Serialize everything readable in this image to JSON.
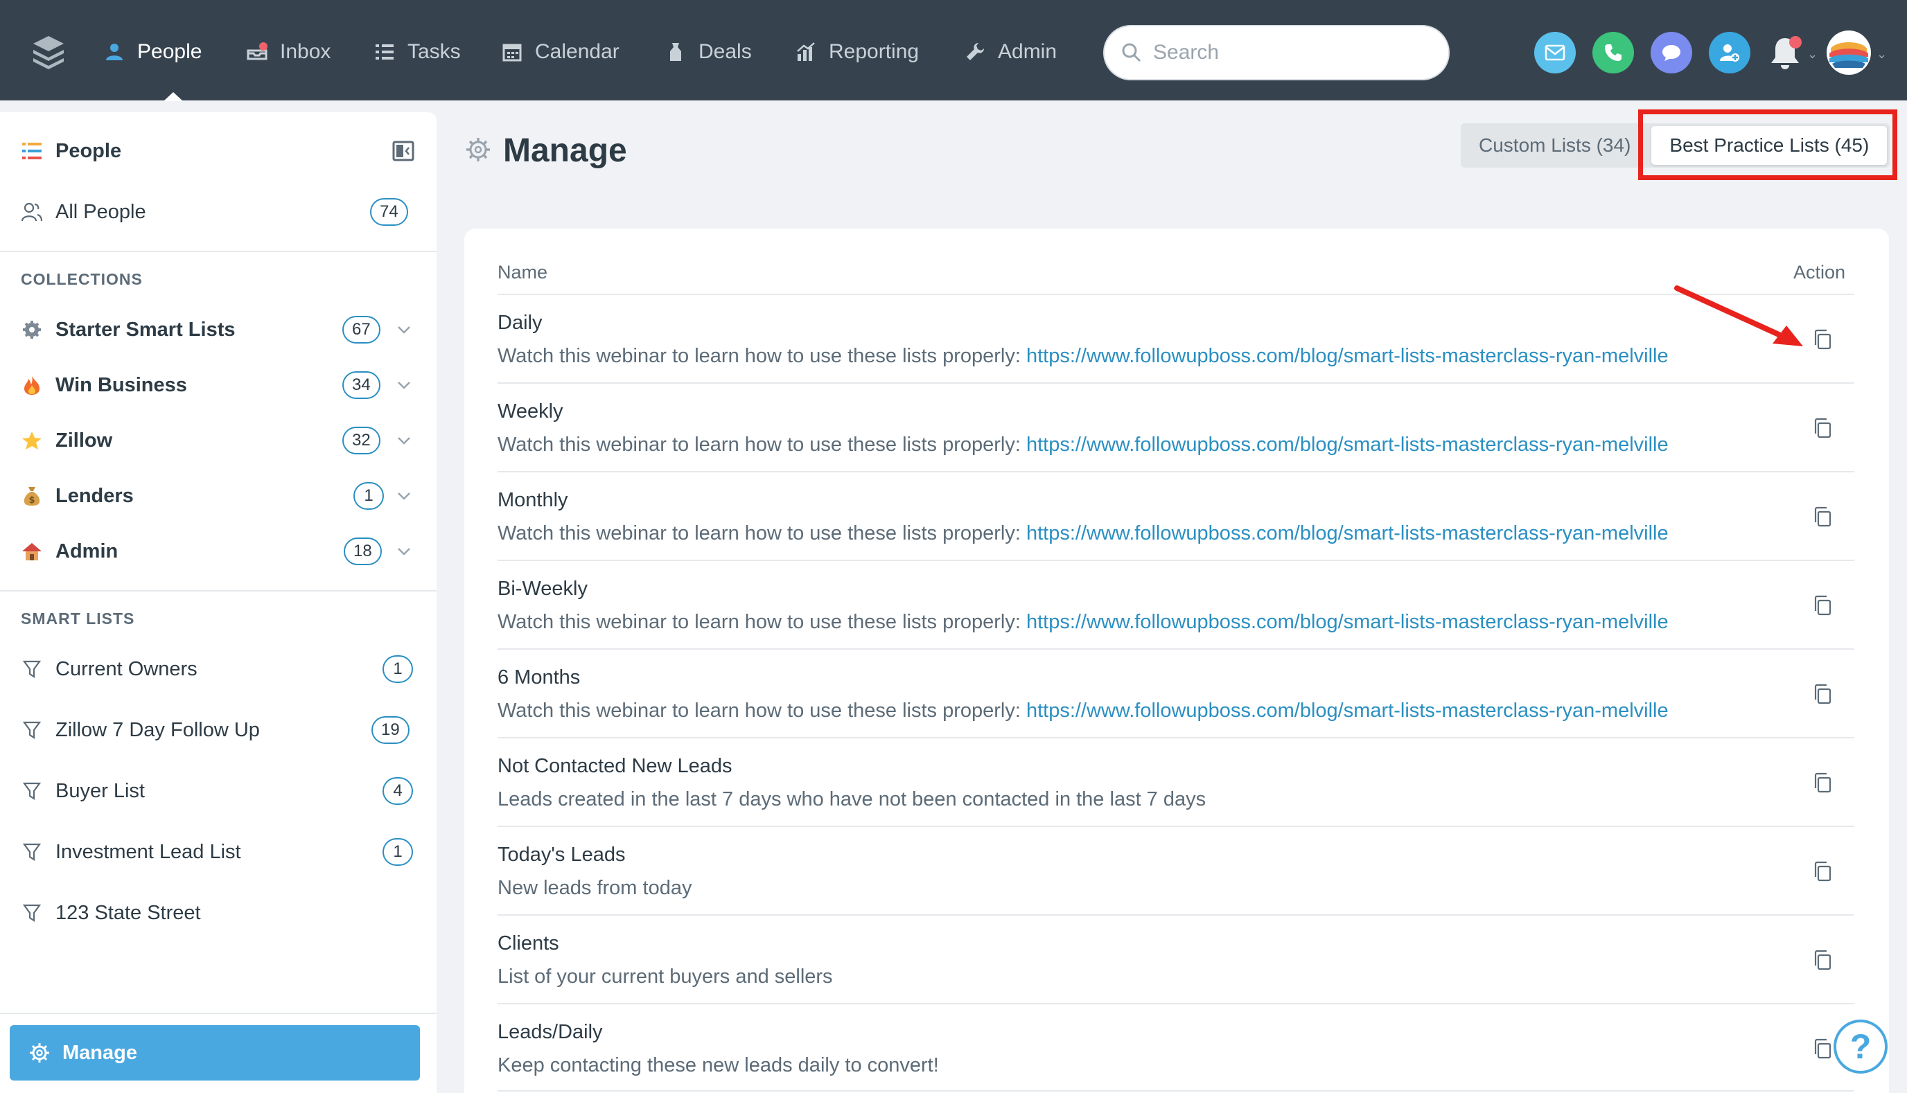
{
  "topnav": {
    "items": [
      {
        "label": "People",
        "icon": "person-icon",
        "active": true
      },
      {
        "label": "Inbox",
        "icon": "inbox-icon"
      },
      {
        "label": "Tasks",
        "icon": "tasks-icon"
      },
      {
        "label": "Calendar",
        "icon": "calendar-icon"
      },
      {
        "label": "Deals",
        "icon": "deals-icon"
      },
      {
        "label": "Reporting",
        "icon": "reporting-icon"
      },
      {
        "label": "Admin",
        "icon": "wrench-icon"
      }
    ],
    "search_placeholder": "Search",
    "quick_actions": [
      {
        "icon": "email-icon",
        "color": "#5bc0eb"
      },
      {
        "icon": "phone-icon",
        "color": "#3cc47c"
      },
      {
        "icon": "chat-icon",
        "color": "#7b8cf0"
      },
      {
        "icon": "add-person-icon",
        "color": "#3aa8e0"
      }
    ]
  },
  "sidebar": {
    "title": "People",
    "all_people": {
      "label": "All People",
      "count": "74"
    },
    "collections_heading": "COLLECTIONS",
    "collections": [
      {
        "label": "Starter Smart Lists",
        "count": "67",
        "icon": "gear-emoji-icon"
      },
      {
        "label": "Win Business",
        "count": "34",
        "icon": "fire-emoji-icon"
      },
      {
        "label": "Zillow",
        "count": "32",
        "icon": "star-emoji-icon"
      },
      {
        "label": "Lenders",
        "count": "1",
        "icon": "money-bag-emoji-icon"
      },
      {
        "label": "Admin",
        "count": "18",
        "icon": "house-emoji-icon"
      }
    ],
    "smart_lists_heading": "SMART LISTS",
    "smart_lists": [
      {
        "label": "Current Owners",
        "count": "1"
      },
      {
        "label": "Zillow 7 Day Follow Up",
        "count": "19"
      },
      {
        "label": "Buyer List",
        "count": "4"
      },
      {
        "label": "Investment Lead List",
        "count": "1"
      },
      {
        "label": "123 State Street",
        "count": ""
      }
    ],
    "manage_label": "Manage"
  },
  "main": {
    "title": "Manage",
    "tabs": [
      {
        "label": "Custom Lists (34)",
        "selected": false
      },
      {
        "label": "Best Practice Lists (45)",
        "selected": true
      }
    ],
    "table": {
      "col_name": "Name",
      "col_action": "Action",
      "rows": [
        {
          "name": "Daily",
          "desc": "Watch this webinar to learn how to use these lists properly: ",
          "link": "https://www.followupboss.com/blog/smart-lists-masterclass-ryan-melville"
        },
        {
          "name": "Weekly",
          "desc": "Watch this webinar to learn how to use these lists properly: ",
          "link": "https://www.followupboss.com/blog/smart-lists-masterclass-ryan-melville"
        },
        {
          "name": "Monthly",
          "desc": "Watch this webinar to learn how to use these lists properly: ",
          "link": "https://www.followupboss.com/blog/smart-lists-masterclass-ryan-melville"
        },
        {
          "name": "Bi-Weekly",
          "desc": "Watch this webinar to learn how to use these lists properly: ",
          "link": "https://www.followupboss.com/blog/smart-lists-masterclass-ryan-melville"
        },
        {
          "name": "6 Months",
          "desc": "Watch this webinar to learn how to use these lists properly: ",
          "link": "https://www.followupboss.com/blog/smart-lists-masterclass-ryan-melville"
        },
        {
          "name": "Not Contacted New Leads",
          "desc": "Leads created in the last 7 days who have not been contacted in the last 7 days",
          "link": ""
        },
        {
          "name": "Today's Leads",
          "desc": "New leads from today",
          "link": ""
        },
        {
          "name": "Clients",
          "desc": "List of your current buyers and sellers",
          "link": ""
        },
        {
          "name": "Leads/Daily",
          "desc": "Keep contacting these new leads daily to convert!",
          "link": ""
        }
      ]
    },
    "help_label": "?"
  },
  "colors": {
    "topbar": "#36434f",
    "accent": "#4aa8e0",
    "link": "#2a8fc2",
    "annotation": "#e8231d"
  }
}
